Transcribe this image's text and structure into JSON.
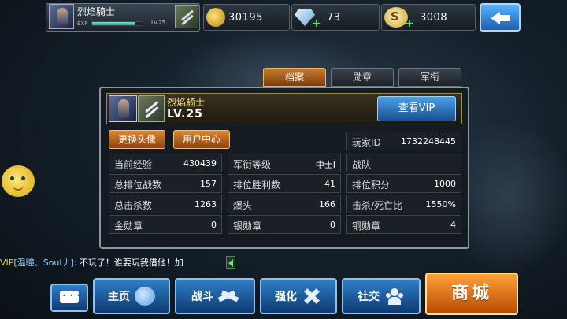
{
  "topbar": {
    "player_name": "烈焰騎士",
    "exp_label": "EXP",
    "exp_fraction": 0.84,
    "level_small": "LV.25",
    "gold": "30195",
    "diamond": "73",
    "silver": "3008",
    "silver_symbol": "S"
  },
  "tabs": [
    {
      "label": "档案",
      "active": true
    },
    {
      "label": "勋章",
      "active": false
    },
    {
      "label": "军衔",
      "active": false
    }
  ],
  "profile": {
    "name": "烈焰騎士",
    "level": "LV.25",
    "vip_button": "查看VIP",
    "change_avatar": "更换头像",
    "user_center": "用户中心",
    "player_id_label": "玩家ID",
    "player_id": "1732248445"
  },
  "stats": {
    "exp": {
      "label": "当前经验",
      "value": "430439"
    },
    "rank": {
      "label": "军衔等级",
      "value": "中士I"
    },
    "team": {
      "label": "战队",
      "value": ""
    },
    "ranked_battles": {
      "label": "总排位战数",
      "value": "157"
    },
    "ranked_wins": {
      "label": "排位胜利数",
      "value": "41"
    },
    "ranked_points": {
      "label": "排位积分",
      "value": "1000"
    },
    "kills": {
      "label": "总击杀数",
      "value": "1263"
    },
    "headshots": {
      "label": "爆头",
      "value": "166"
    },
    "kd": {
      "label": "击杀/死亡比",
      "value": "1550%"
    },
    "gold_medals": {
      "label": "金勋章",
      "value": "0"
    },
    "silver_medals": {
      "label": "银勋章",
      "value": "0"
    },
    "bronze_medals": {
      "label": "铜勋章",
      "value": "4"
    }
  },
  "chat": {
    "vip": "VIP",
    "channel": "[温瞳、Soul丿]:",
    "message": "不玩了！谁要玩我借他！加"
  },
  "nav": {
    "home": "主页",
    "battle": "战斗",
    "upgrade": "强化",
    "social": "社交",
    "shop": "商城"
  },
  "colors": {
    "accent_orange": "#e08830",
    "accent_blue": "#2f7fc6",
    "vip_yellow": "#d8d040"
  }
}
